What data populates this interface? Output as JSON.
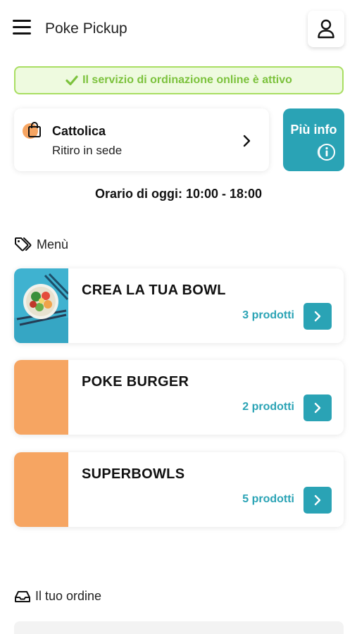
{
  "header": {
    "title": "Poke Pickup",
    "menu_icon": "hamburger-icon",
    "user_icon": "user-icon"
  },
  "status_banner": {
    "text": "Il servizio di ordinazione online è attivo",
    "icon": "check-icon",
    "color": "#7cc23d",
    "background": "#eefadf"
  },
  "store": {
    "name": "Cattolica",
    "mode": "Ritiro in sede",
    "icon": "shopping-bag-icon",
    "chevron_icon": "chevron-right-icon"
  },
  "info_button": {
    "label": "Più info",
    "icon": "info-icon"
  },
  "hours": {
    "text": "Orario di oggi: 10:00 - 18:00"
  },
  "menu_section": {
    "title": "Menù",
    "icon": "tag-icon",
    "items": [
      {
        "name": "CREA LA TUA BOWL",
        "count": "3 prodotti",
        "thumb": "poke-bowl-photo"
      },
      {
        "name": "POKE BURGER",
        "count": "2 prodotti",
        "thumb": "orange-placeholder"
      },
      {
        "name": "SUPERBOWLS",
        "count": "5 prodotti",
        "thumb": "orange-placeholder"
      }
    ]
  },
  "order_section": {
    "title": "Il tuo ordine",
    "icon": "inbox-icon"
  },
  "colors": {
    "accent": "#2aa3b5",
    "placeholder": "#f6a562",
    "success": "#a9de62"
  }
}
